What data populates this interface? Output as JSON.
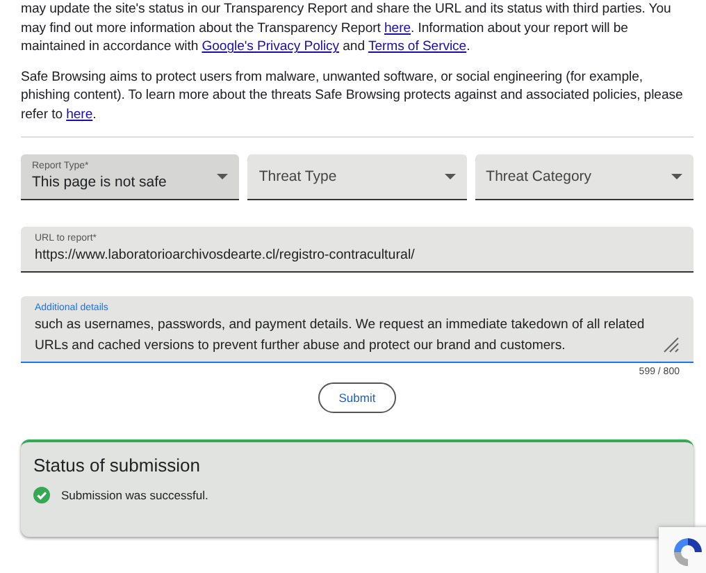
{
  "intro_paragraphs": [
    [
      {
        "text": "may update the site's status in our Transparency Report and share the URL and its status with third parties. You may find out more information about the Transparency Report ",
        "link": false
      },
      {
        "text": "here",
        "link": true
      },
      {
        "text": ". Information about your report will be maintained in accordance with ",
        "link": false
      },
      {
        "text": "Google's Privacy Policy",
        "link": true
      },
      {
        "text": " and ",
        "link": false
      },
      {
        "text": "Terms of Service",
        "link": true
      },
      {
        "text": ".",
        "link": false
      }
    ],
    [
      {
        "text": "Safe Browsing aims to protect users from malware, unwanted software, or social engineering (for example, phishing content). To learn more about the threats Safe Browsing protects against and associated policies, please refer to ",
        "link": false
      },
      {
        "text": "here",
        "link": true
      },
      {
        "text": ".",
        "link": false
      }
    ]
  ],
  "selects": [
    {
      "label": "Report Type*",
      "value": "This page is not safe",
      "focused": true
    },
    {
      "placeholder": "Threat Type",
      "focused": false
    },
    {
      "placeholder": "Threat Category",
      "focused": false
    }
  ],
  "url_field": {
    "label": "URL to report*",
    "value": "https://www.laboratorioarchivosdearte.cl/registro-contracultural/"
  },
  "details_field": {
    "label": "Additional details",
    "value": "such as usernames, passwords, and payment details. We request an immediate takedown of all related URLs and cached versions to prevent further abuse and protect our brand and customers.",
    "focused": true,
    "counter": "599 / 800"
  },
  "submit_button": "Submit",
  "status": {
    "title": "Status of submission",
    "message": "Submission was successful.",
    "success": true
  }
}
